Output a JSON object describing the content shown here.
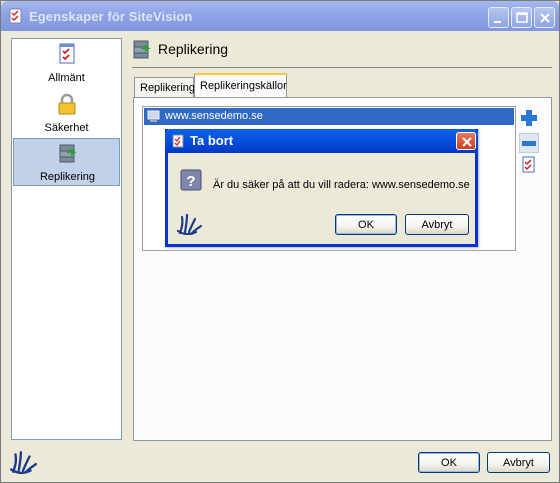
{
  "window": {
    "title": "Egenskaper för SiteVision"
  },
  "nav": {
    "items": [
      {
        "label": "Allmänt",
        "icon": "checklist-icon",
        "selected": false
      },
      {
        "label": "Säkerhet",
        "icon": "padlock-icon",
        "selected": false
      },
      {
        "label": "Replikering",
        "icon": "replication-icon",
        "selected": true
      }
    ]
  },
  "header": {
    "title": "Replikering"
  },
  "tabs": [
    {
      "label": "Replikering",
      "active": false
    },
    {
      "label": "Replikeringskällor",
      "active": true
    }
  ],
  "list": {
    "rows": [
      {
        "label": "www.sensedemo.se",
        "selected": true
      }
    ]
  },
  "side_buttons": [
    "add-icon",
    "remove-icon",
    "edit-icon"
  ],
  "dialog": {
    "title": "Ta bort",
    "message": "Är du säker på att du vill radera: www.sensedemo.se",
    "ok_label": "OK",
    "cancel_label": "Avbryt"
  },
  "footer": {
    "ok_label": "OK",
    "cancel_label": "Avbryt"
  },
  "colors": {
    "selection": "#316ac5",
    "dialog_title": "#0345d4",
    "tab_highlight": "#ffc83c"
  }
}
